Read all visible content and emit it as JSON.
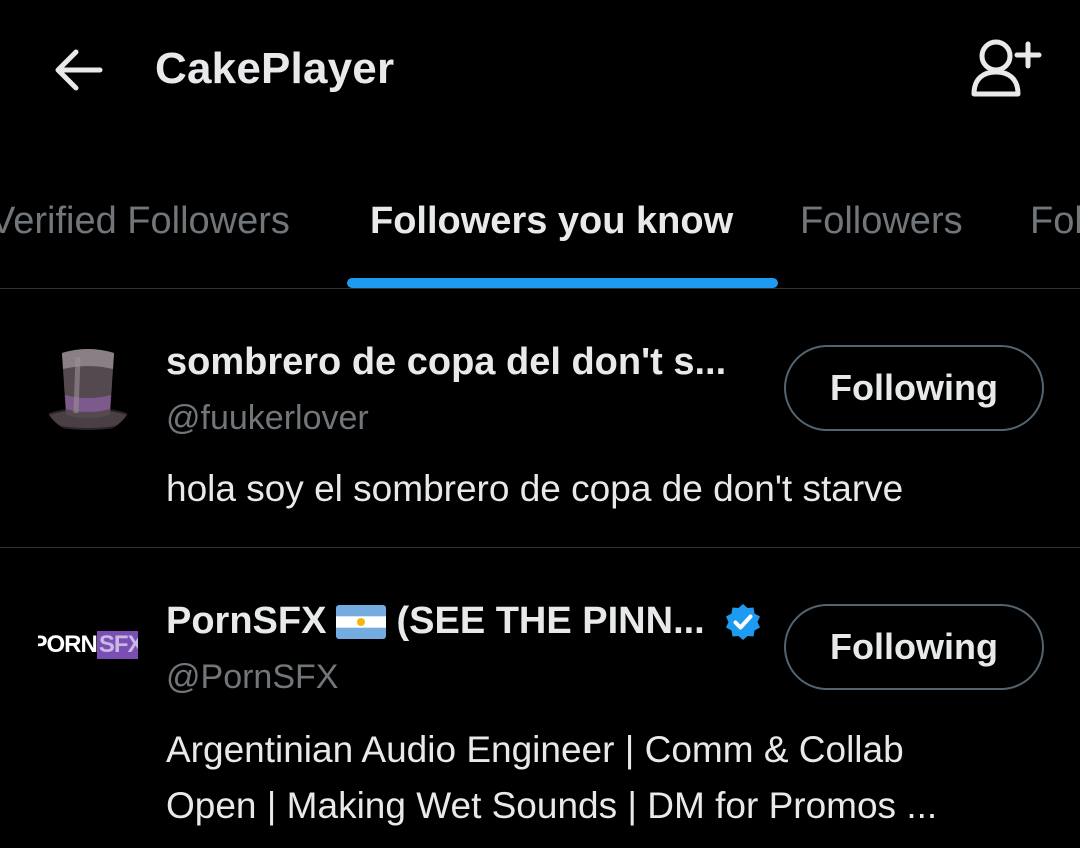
{
  "header": {
    "title": "CakePlayer"
  },
  "tabs": [
    {
      "label": "Verified Followers",
      "active": false
    },
    {
      "label": "Followers you know",
      "active": true
    },
    {
      "label": "Followers",
      "active": false
    },
    {
      "label": "Following",
      "active": false
    }
  ],
  "users": [
    {
      "name": "sombrero de copa del don't s...",
      "handle": "@fuukerlover",
      "bio": "hola soy el sombrero de copa de don't starve",
      "button_label": "Following",
      "verified": false,
      "avatar_icon": "top-hat-icon"
    },
    {
      "name_before_flag": "PornSFX",
      "name_after_flag": "(SEE THE PINN...",
      "handle": "@PornSFX",
      "bio_line1": "Argentinian Audio Engineer | Comm & Collab",
      "bio_line2": "Open | Making Wet Sounds | DM for Promos ...",
      "button_label": "Following",
      "verified": true,
      "avatar_logo_part1": "PORN",
      "avatar_logo_part2": "SFX",
      "flag_icon": "argentina-flag-icon"
    }
  ],
  "colors": {
    "background": "#000000",
    "text_primary": "#e7e9ea",
    "text_secondary": "#71767b",
    "accent": "#1d9bf0",
    "divider": "#2f3336"
  }
}
